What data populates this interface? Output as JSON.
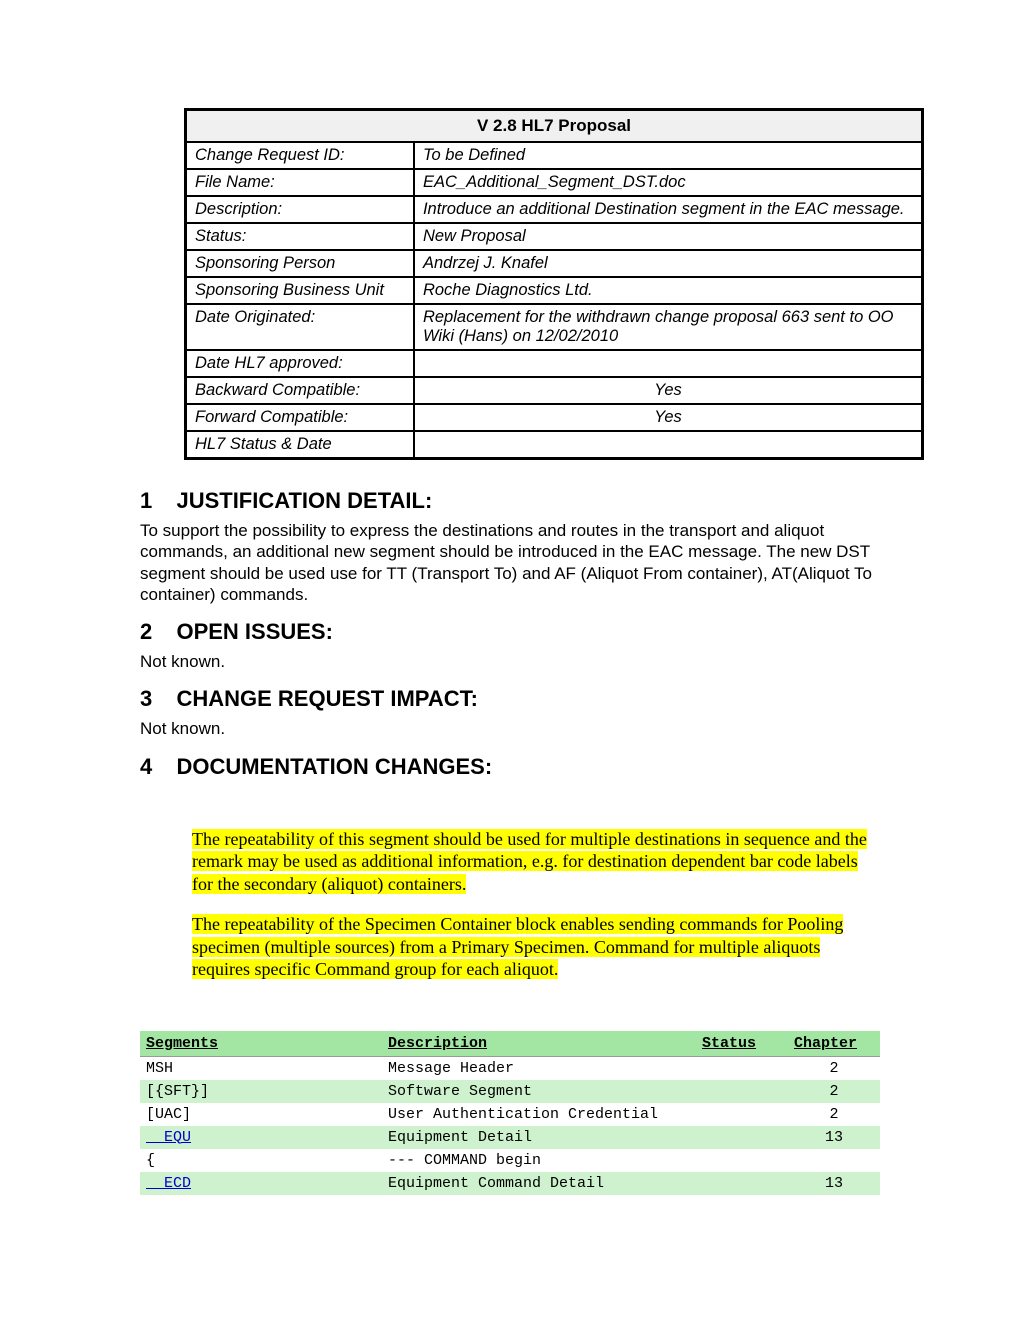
{
  "meta": {
    "title": "V 2.8 HL7 Proposal",
    "rows": [
      {
        "label": "Change Request ID:",
        "value": "To be Defined"
      },
      {
        "label": "File Name:",
        "value": "EAC_Additional_Segment_DST.doc"
      },
      {
        "label": "Description:",
        "value": "Introduce an additional Destination segment in the EAC message."
      },
      {
        "label": "Status:",
        "value": "New Proposal"
      },
      {
        "label": "Sponsoring Person",
        "value": "Andrzej J. Knafel"
      },
      {
        "label": "Sponsoring Business Unit",
        "value": "Roche Diagnostics Ltd."
      },
      {
        "label": "Date Originated:",
        "value": "Replacement for the withdrawn change proposal 663 sent to OO Wiki (Hans) on 12/02/2010",
        "indent": true
      },
      {
        "label": "Date HL7 approved:",
        "value": ""
      },
      {
        "label": "Backward Compatible:",
        "value": "Yes",
        "center": true
      },
      {
        "label": "Forward Compatible:",
        "value": "Yes",
        "center": true
      },
      {
        "label": "HL7 Status & Date",
        "value": ""
      }
    ]
  },
  "sections": {
    "s1": {
      "num": "1",
      "title": "JUSTIFICATION DETAIL:",
      "body": "To support the possibility to express the destinations and routes in the transport and aliquot commands, an additional new segment should be introduced in the EAC message. The new DST segment should be used use for TT (Transport To) and AF (Aliquot From container), AT(Aliquot To container) commands."
    },
    "s2": {
      "num": "2",
      "title": "OPEN ISSUES:",
      "body": "Not known."
    },
    "s3": {
      "num": "3",
      "title": "CHANGE REQUEST IMPACT:",
      "body": "Not known."
    },
    "s4": {
      "num": "4",
      "title": "DOCUMENTATION CHANGES:"
    }
  },
  "highlights": {
    "p1": "The repeatability of this segment should be used for multiple destinations in sequence and the remark may be used as additional information, e.g. for destination dependent bar code labels for the secondary (aliquot) containers.",
    "p2": "The repeatability of the Specimen Container block enables sending commands for Pooling specimen (multiple sources) from a Primary Specimen. Command for multiple aliquots requires specific Command group for each aliquot."
  },
  "segTable": {
    "headers": {
      "segments": "Segments",
      "description": "Description",
      "status": "Status",
      "chapter": "Chapter"
    },
    "rows": [
      {
        "seg": "MSH",
        "desc": "Message Header",
        "status": "",
        "chapter": "2",
        "link": false,
        "alt": false
      },
      {
        "seg": "[{SFT}]",
        "desc": "Software Segment",
        "status": "",
        "chapter": "2",
        "link": false,
        "alt": true
      },
      {
        "seg": "[UAC]",
        "desc": "User Authentication Credential",
        "status": "",
        "chapter": "2",
        "link": false,
        "alt": false
      },
      {
        "seg": "EQU",
        "desc": "Equipment Detail",
        "status": "",
        "chapter": "13",
        "link": true,
        "alt": true
      },
      {
        "seg": "{",
        "desc": "--- COMMAND begin",
        "status": "",
        "chapter": "",
        "link": false,
        "alt": false
      },
      {
        "seg": "ECD",
        "desc": "Equipment Command Detail",
        "status": "",
        "chapter": "13",
        "link": true,
        "alt": true
      }
    ]
  }
}
